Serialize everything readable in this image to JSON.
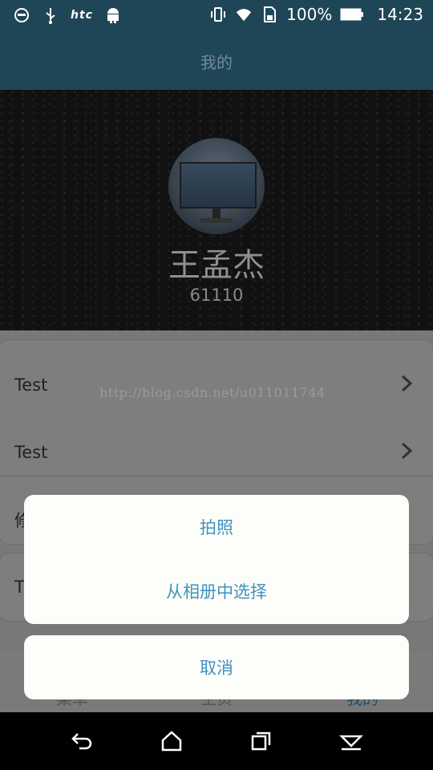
{
  "status_bar": {
    "carrier": "htc",
    "battery": "100%",
    "time": "14:23"
  },
  "title_bar": {
    "title": "我的"
  },
  "profile": {
    "name": "王孟杰",
    "id": "61110"
  },
  "list": {
    "rows": [
      {
        "label": "Test"
      },
      {
        "label": "Test"
      },
      {
        "label": "修"
      },
      {
        "label": "T"
      }
    ]
  },
  "watermark": "http://blog.csdn.net/u011011744",
  "tabbar": {
    "tabs": [
      {
        "label": "菜单"
      },
      {
        "label": "主页"
      },
      {
        "label": "我的"
      }
    ]
  },
  "action_sheet": {
    "options": [
      "拍照",
      "从相册中选择"
    ],
    "cancel": "取消"
  },
  "colors": {
    "primary": "#1f4657",
    "accent": "#3f93bf",
    "sheet_bg": "#fdfdfa"
  }
}
